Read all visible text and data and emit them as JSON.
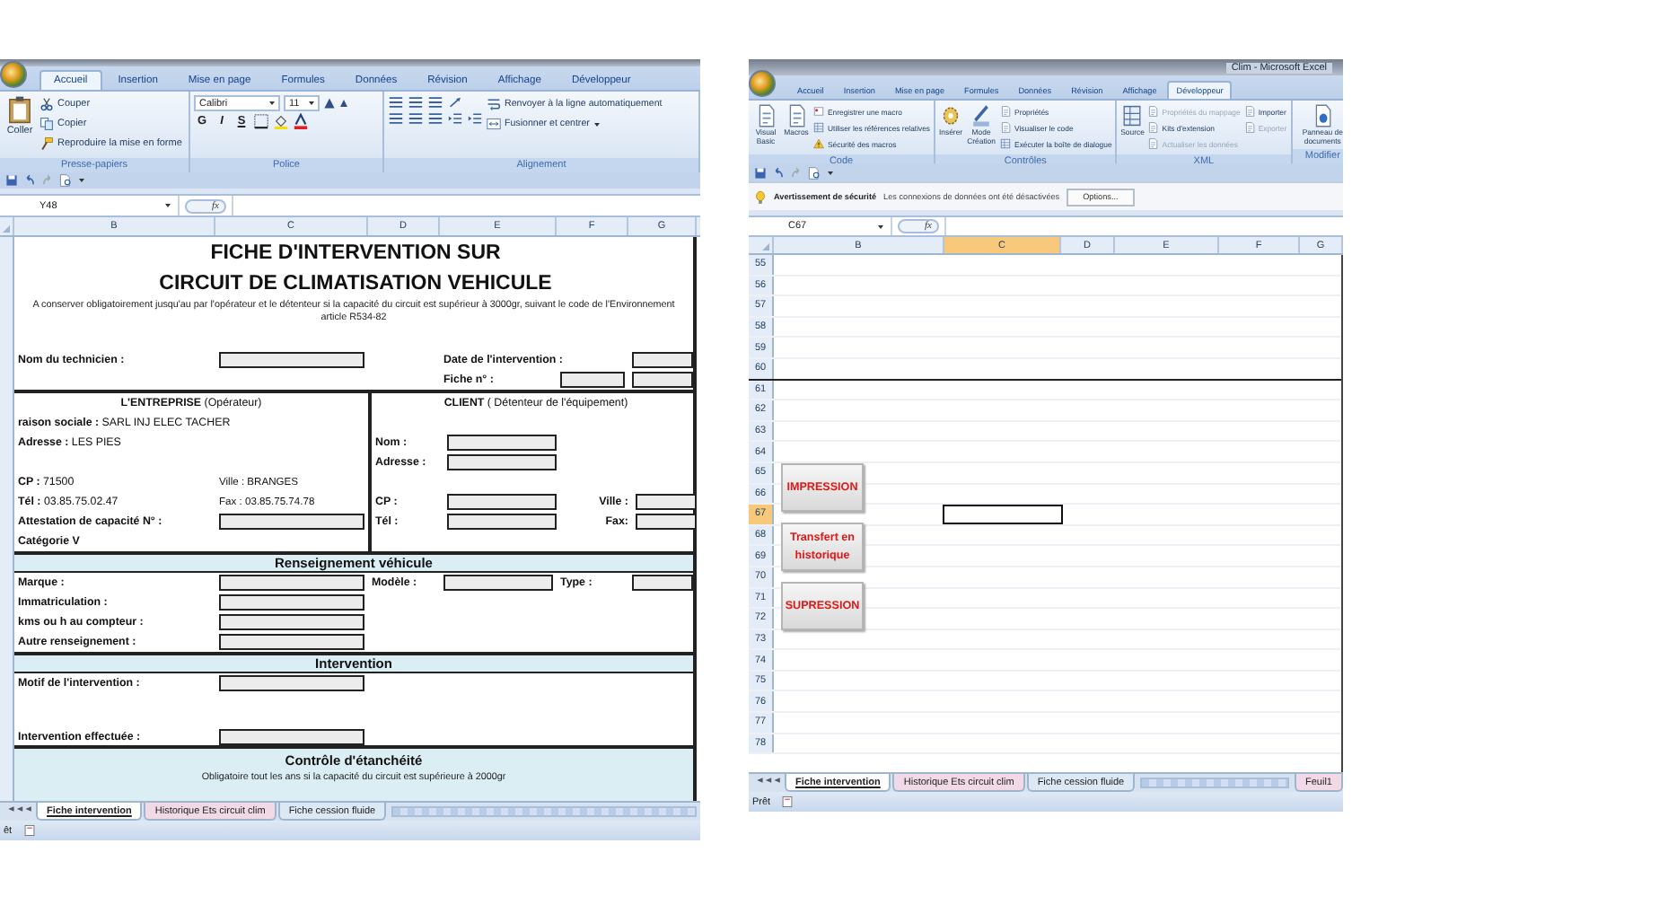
{
  "left_window": {
    "ribbon_tabs": [
      {
        "label": "Accueil",
        "selected": true
      },
      {
        "label": "Insertion",
        "selected": false
      },
      {
        "label": "Mise en page",
        "selected": false
      },
      {
        "label": "Formules",
        "selected": false
      },
      {
        "label": "Données",
        "selected": false
      },
      {
        "label": "Révision",
        "selected": false
      },
      {
        "label": "Affichage",
        "selected": false
      },
      {
        "label": "Développeur",
        "selected": false
      }
    ],
    "clipboard": {
      "paste": "Coller",
      "items": [
        "Couper",
        "Copier",
        "Reproduire la mise en forme"
      ],
      "label": "Presse-papiers"
    },
    "font": {
      "name": "Calibri",
      "size": "11",
      "style_buttons": [
        "G",
        "I",
        "S"
      ],
      "label": "Police"
    },
    "alignment": {
      "wrap": "Renvoyer à la ligne automatiquement",
      "merge": "Fusionner et centrer",
      "label": "Alignement"
    },
    "name_box": "Y48",
    "formula_icon": "fx",
    "columns": [
      {
        "label": "B",
        "selected": false
      },
      {
        "label": "C",
        "selected": false
      },
      {
        "label": "D",
        "selected": false
      },
      {
        "label": "E",
        "selected": false
      },
      {
        "label": "F",
        "selected": false
      },
      {
        "label": "G",
        "selected": false
      }
    ],
    "form": {
      "title_lines": [
        "FICHE  D'INTERVENTION SUR",
        "CIRCUIT DE CLIMATISATION VEHICULE"
      ],
      "note": "A conserver obligatoirement jusqu'au  par l'opérateur et le détenteur si la capacité du circuit est supérieur à 3000gr, suivant le code de l'Environnement article R534-82",
      "technician_label": "Nom du technicien :",
      "date_label": "Date de l'intervention :",
      "sheet_number_label": "Fiche n° :",
      "company": {
        "heading": "**L'ENTREPRISE** (Opérateur)",
        "name_line": "**raison sociale :** SARL INJ ELEC TACHER",
        "address_line": "**Adresse :** LES PIES",
        "postcode_line": "**CP :** 71500",
        "city_line": "Ville : BRANGES",
        "phone_line": "**Tél :** 03.85.75.02.47",
        "fax_line": "Fax : 03.85.75.74.78",
        "certificate_label": "Attestation de capacité N° :",
        "category": "Catégorie V"
      },
      "client": {
        "heading": "**CLIENT** ( Détenteur de  l'équipement)",
        "name_label": "Nom :",
        "address_label": "Adresse :",
        "postcode_label": "CP :",
        "city_label": "Ville :",
        "phone_label": "Tél :",
        "fax_label": "Fax:"
      },
      "vehicle": {
        "title": "Renseignement véhicule",
        "brand_label": "Marque :",
        "model_label": "Modèle :",
        "type_label": "Type :",
        "other_labels": [
          "Immatriculation :",
          "kms ou h au compteur :",
          "Autre renseignement :"
        ]
      },
      "intervention": {
        "title": "Intervention",
        "reason_label": "Motif de l'intervention :",
        "done_label": "Intervention effectuée :"
      },
      "leak_check": {
        "title": "Contrôle d'étanchéité",
        "note": "Obligatoire tout les ans si la capacité du circuit est supérieure à 2000gr"
      }
    },
    "sheet_tabs": [
      {
        "label": "Fiche intervention",
        "selected": true
      },
      {
        "label": "Historique Ets circuit clim",
        "selected": false
      },
      {
        "label": "Fiche cession fluide",
        "selected": false
      }
    ],
    "status": "êt"
  },
  "right_window": {
    "title": "Clim - Microsoft Excel",
    "ribbon_tabs": [
      {
        "label": "Accueil",
        "selected": false
      },
      {
        "label": "Insertion",
        "selected": false
      },
      {
        "label": "Mise en page",
        "selected": false
      },
      {
        "label": "Formules",
        "selected": false
      },
      {
        "label": "Données",
        "selected": false
      },
      {
        "label": "Révision",
        "selected": false
      },
      {
        "label": "Affichage",
        "selected": false
      },
      {
        "label": "Développeur",
        "selected": true
      }
    ],
    "code": {
      "large": [
        "Visual Basic",
        "Macros"
      ],
      "items": [
        "Enregistrer une macro",
        "Utiliser les références relatives",
        "Sécurité des macros"
      ],
      "label": "Code"
    },
    "controls": {
      "large": [
        "Insérer",
        "Mode Création"
      ],
      "items": [
        "Propriétés",
        "Visualiser le code",
        "Exécuter la boîte de dialogue"
      ],
      "label": "Contrôles"
    },
    "xml": {
      "large": [
        "Source"
      ],
      "items": [
        {
          "label": "Propriétés du mappage",
          "disabled": true
        },
        {
          "label": "Kits d'extension",
          "disabled": false
        },
        {
          "label": "Actualiser les données",
          "disabled": true
        }
      ],
      "side_items": [
        {
          "label": "Importer",
          "disabled": false
        },
        {
          "label": "Exporter",
          "disabled": true
        }
      ],
      "label": "XML"
    },
    "modify": {
      "large": [
        "Panneau de documents"
      ],
      "label": "Modifier"
    },
    "security": {
      "title": "Avertissement de sécurité",
      "message": "Les connexions de données ont été désactivées",
      "button": "Options..."
    },
    "name_box": "C67",
    "formula_icon": "fx",
    "columns": [
      {
        "label": "B",
        "selected": false
      },
      {
        "label": "C",
        "selected": true
      },
      {
        "label": "D",
        "selected": false
      },
      {
        "label": "E",
        "selected": false
      },
      {
        "label": "F",
        "selected": false
      },
      {
        "label": "G",
        "selected": false
      }
    ],
    "rows": [
      {
        "label": "55",
        "selected": false
      },
      {
        "label": "56",
        "selected": false
      },
      {
        "label": "57",
        "selected": false
      },
      {
        "label": "58",
        "selected": false
      },
      {
        "label": "59",
        "selected": false
      },
      {
        "label": "60",
        "selected": false
      },
      {
        "label": "61",
        "selected": false
      },
      {
        "label": "62",
        "selected": false
      },
      {
        "label": "63",
        "selected": false
      },
      {
        "label": "64",
        "selected": false
      },
      {
        "label": "65",
        "selected": false
      },
      {
        "label": "66",
        "selected": false
      },
      {
        "label": "67",
        "selected": true
      },
      {
        "label": "68",
        "selected": false
      },
      {
        "label": "69",
        "selected": false
      },
      {
        "label": "70",
        "selected": false
      },
      {
        "label": "71",
        "selected": false
      },
      {
        "label": "72",
        "selected": false
      },
      {
        "label": "73",
        "selected": false
      },
      {
        "label": "74",
        "selected": false
      },
      {
        "label": "75",
        "selected": false
      },
      {
        "label": "76",
        "selected": false
      },
      {
        "label": "77",
        "selected": false
      },
      {
        "label": "78",
        "selected": false
      }
    ],
    "buttons": [
      "IMPRESSION",
      "Transfert en historique",
      "SUPRESSION"
    ],
    "sheet_tabs": [
      {
        "label": "Fiche intervention",
        "selected": true
      },
      {
        "label": "Historique Ets circuit clim",
        "selected": false
      },
      {
        "label": "Fiche cession fluide",
        "selected": false
      },
      {
        "label": "Feuil1",
        "selected": false
      }
    ],
    "status": "Prêt"
  }
}
